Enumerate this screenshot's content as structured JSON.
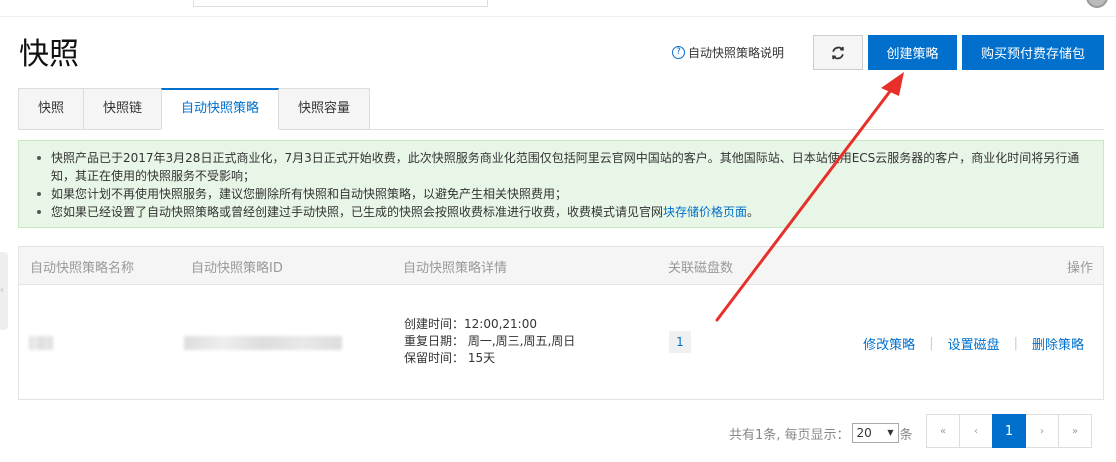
{
  "page": {
    "title": "快照"
  },
  "header": {
    "help_text": "自动快照策略说明",
    "refresh_label": "",
    "create_label": "创建策略",
    "buy_label": "购买预付费存储包"
  },
  "tabs": [
    {
      "label": "快照"
    },
    {
      "label": "快照链"
    },
    {
      "label": "自动快照策略"
    },
    {
      "label": "快照容量"
    }
  ],
  "notice": {
    "line1": "快照产品已于2017年3月28日正式商业化，7月3日正式开始收费，此次快照服务商业化范围仅包括阿里云官网中国站的客户。其他国际站、日本站使用ECS云服务器的客户，商业化时间将另行通知，其正在使用的快照服务不受影响；",
    "line2": "如果您计划不再使用快照服务，建议您删除所有快照和自动快照策略，以避免产生相关快照费用；",
    "line3_prefix": "您如果已经设置了自动快照策略或曾经创建过手动快照，已生成的快照会按照收费标准进行收费，收费模式请见官网",
    "line3_link": "块存储价格页面",
    "line3_suffix": "。"
  },
  "table": {
    "headers": {
      "name": "自动快照策略名称",
      "id": "自动快照策略ID",
      "detail": "自动快照策略详情",
      "disks": "关联磁盘数",
      "ops": "操作"
    },
    "rows": [
      {
        "detail_created": "创建时间：12:00,21:00",
        "detail_repeat": "重复日期： 周一,周三,周五,周日",
        "detail_retain": "保留时间： 15天",
        "disks": "1",
        "op_modify": "修改策略",
        "op_set_disk": "设置磁盘",
        "op_delete": "删除策略"
      }
    ]
  },
  "pagination": {
    "summary": "共有1条, 每页显示：",
    "page_size": "20",
    "unit": "条",
    "first": "«",
    "prev": "‹",
    "current": "1",
    "next": "›",
    "last": "»"
  },
  "colors": {
    "accent": "#0070cc",
    "notice_bg": "#e8f6e7",
    "annotation_arrow": "#e8302a"
  }
}
